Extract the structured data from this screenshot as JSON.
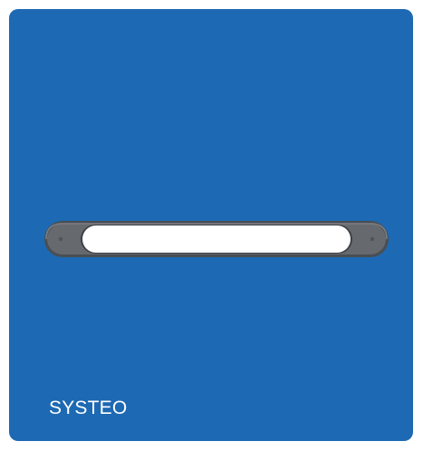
{
  "product_tile": {
    "label": "SYSTEO",
    "background_color": "#1d69b3",
    "label_color": "#ffffff",
    "image": {
      "icon": "linear-led-light-fixture-icon",
      "housing_color": "#5b5f63",
      "diffuser_color": "#ffffff"
    }
  }
}
